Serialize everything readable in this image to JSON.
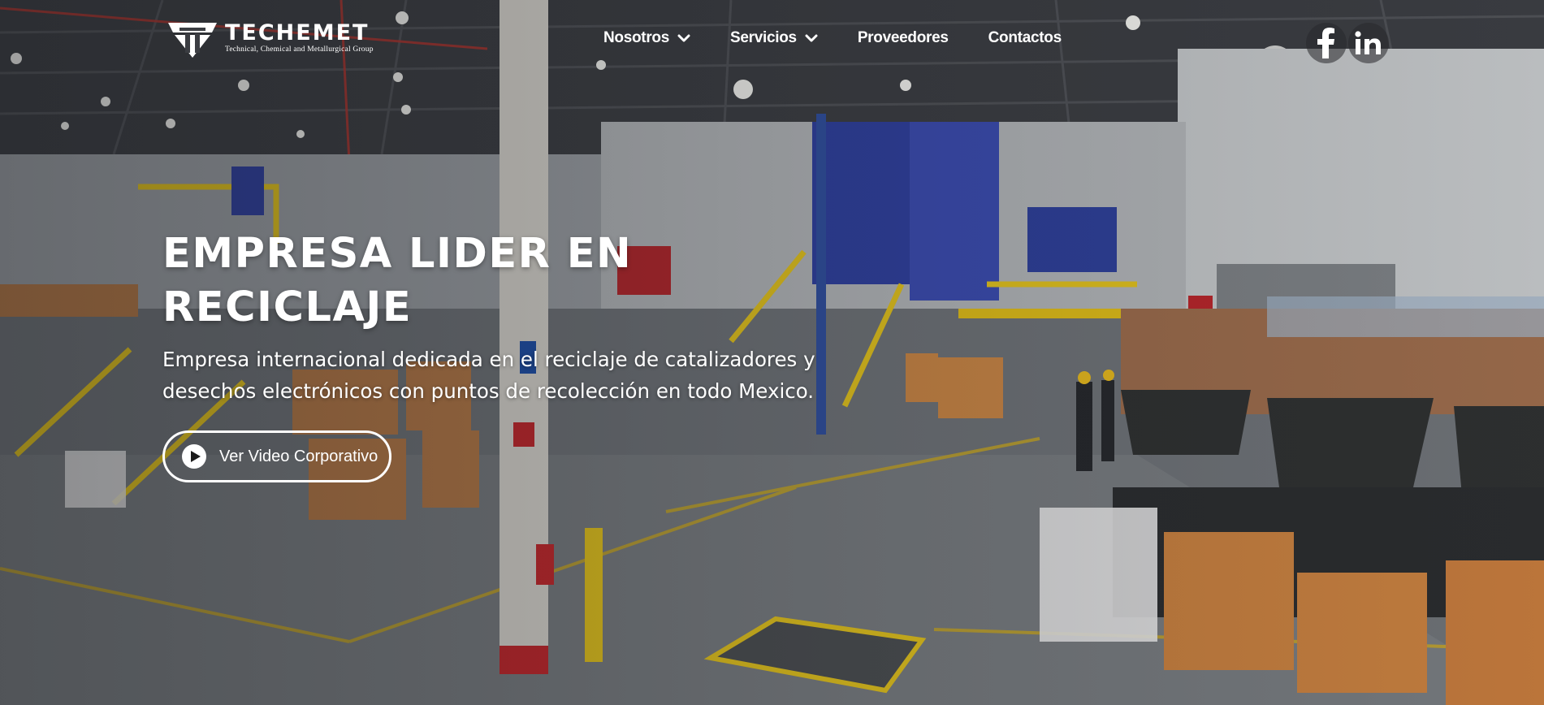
{
  "brand": {
    "name": "TECHEMET",
    "tagline": "Technical, Chemical and Metallurgical Group"
  },
  "nav": {
    "items": [
      {
        "label": "Nosotros",
        "icon": "chevron-down-icon"
      },
      {
        "label": "Servicios",
        "icon": "chevron-down-icon"
      },
      {
        "label": "Proveedores"
      },
      {
        "label": "Contactos"
      }
    ]
  },
  "social": [
    {
      "icon": "facebook-icon"
    },
    {
      "icon": "linkedin-icon"
    }
  ],
  "hero": {
    "headline": "EMPRESA LIDER EN RECICLAJE",
    "subtext": "Empresa internacional dedicada en el reciclaje de catalizadores y desechos electrónicos con puntos de recolección en todo Mexico.",
    "video_button": "Ver Video Corporativo",
    "video_icon": "play-circle-icon"
  },
  "colors": {
    "text": "#ffffff",
    "accent_yellow": "#e8c21a",
    "equipment_blue": "#2e3f9e"
  }
}
